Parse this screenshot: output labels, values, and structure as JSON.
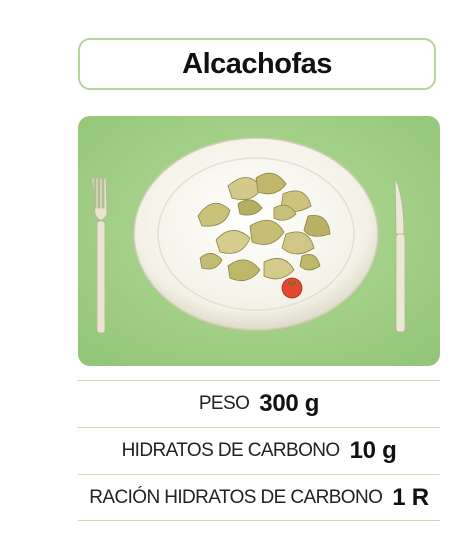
{
  "title": "Alcachofas",
  "photo": {
    "subject": "plate-of-artichokes-icon"
  },
  "rows": [
    {
      "label": "PESO",
      "value": "300 g"
    },
    {
      "label": "HIDRATOS DE CARBONO",
      "value": "10 g"
    },
    {
      "label": "RACIÓN HIDRATOS DE CARBONO",
      "value": "1 R"
    }
  ],
  "colors": {
    "accent_border": "#b9d39a",
    "background_green": "#a9d48f",
    "divider": "#c9dcb0"
  }
}
